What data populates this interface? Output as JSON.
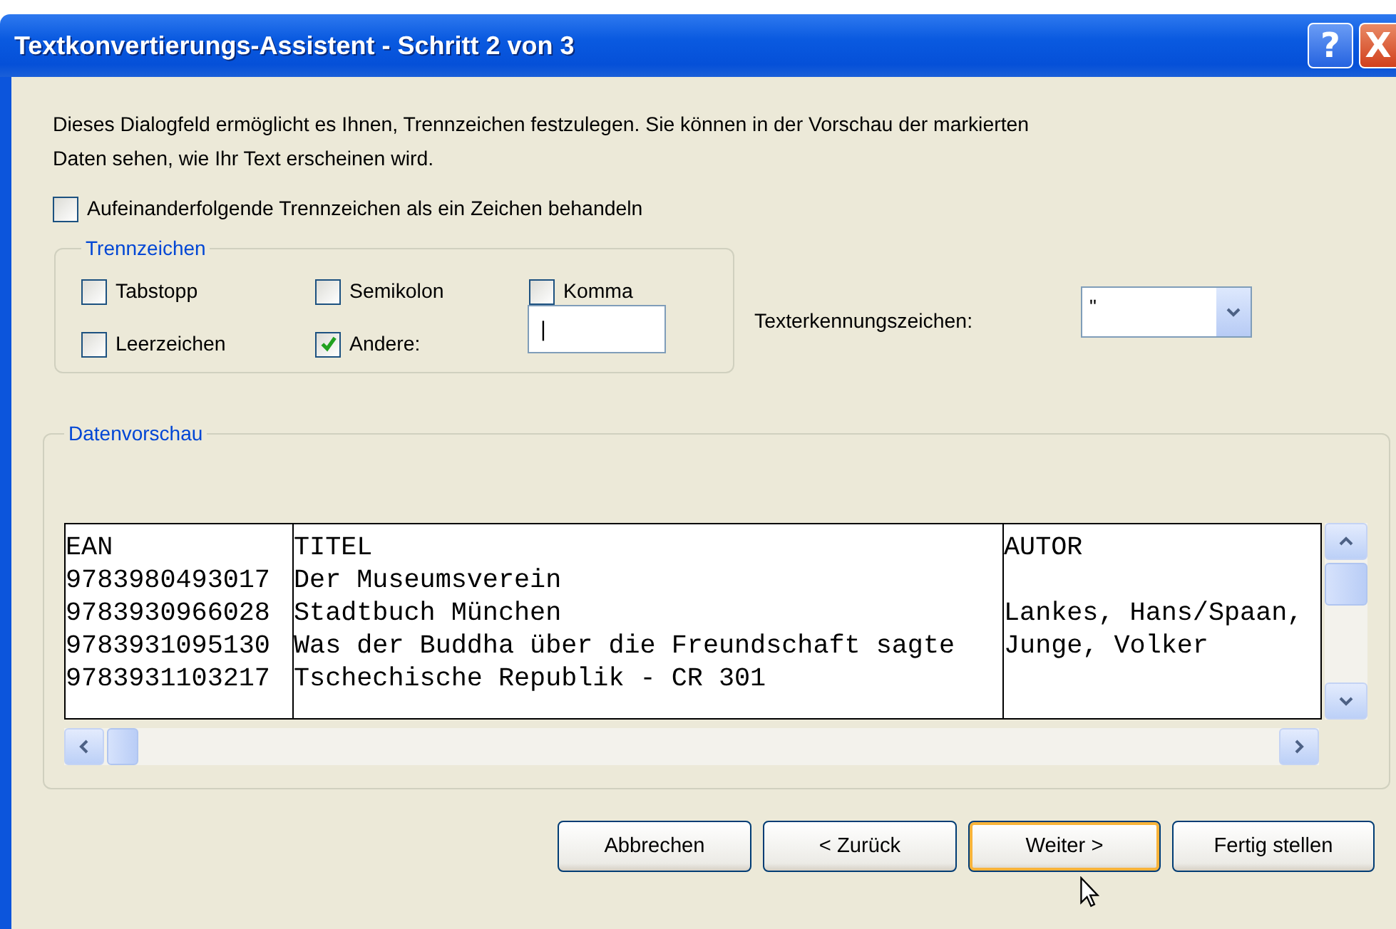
{
  "window": {
    "title": "Textkonvertierungs-Assistent - Schritt 2 von 3",
    "controls": [
      {
        "kind": "help",
        "label": "?"
      },
      {
        "kind": "close",
        "label": "X"
      }
    ]
  },
  "description": "Dieses Dialogfeld ermöglicht es Ihnen, Trennzeichen festzulegen. Sie können in der Vorschau der markierten Daten sehen, wie Ihr Text erscheinen wird.",
  "consecutive": {
    "label": "Aufeinanderfolgende Trennzeichen als ein Zeichen behandeln",
    "checked": false
  },
  "delimiters": {
    "title": "Trennzeichen",
    "items": [
      {
        "label": "Tabstopp",
        "checked": false
      },
      {
        "label": "Semikolon",
        "checked": false
      },
      {
        "label": "Komma",
        "checked": false
      },
      {
        "label": "Leerzeichen",
        "checked": false
      },
      {
        "label": "Andere:",
        "checked": true
      }
    ],
    "other_value": "|"
  },
  "text_qualifier": {
    "label": "Texterkennungszeichen:",
    "value": "\""
  },
  "preview": {
    "title": "Datenvorschau",
    "rows": [
      {
        "cells": [
          "EAN",
          "TITEL",
          "AUTOR"
        ]
      },
      {
        "cells": [
          "9783980493017",
          "Der Museumsverein"
        ]
      },
      {
        "cells": [
          "9783930966028",
          "Stadtbuch München",
          "Lankes, Hans/Spaan,"
        ]
      },
      {
        "cells": [
          "9783931095130",
          "Was der Buddha über die Freundschaft sagte",
          "Junge, Volker"
        ]
      },
      {
        "cells": [
          "9783931103217",
          "Tschechische Republik - CR 301"
        ]
      }
    ]
  },
  "buttons": [
    {
      "label": "Abbrechen",
      "focused": false
    },
    {
      "label": "< Zurück",
      "focused": false
    },
    {
      "label": "Weiter >",
      "focused": true
    },
    {
      "label": "Fertig stellen",
      "focused": false
    }
  ]
}
